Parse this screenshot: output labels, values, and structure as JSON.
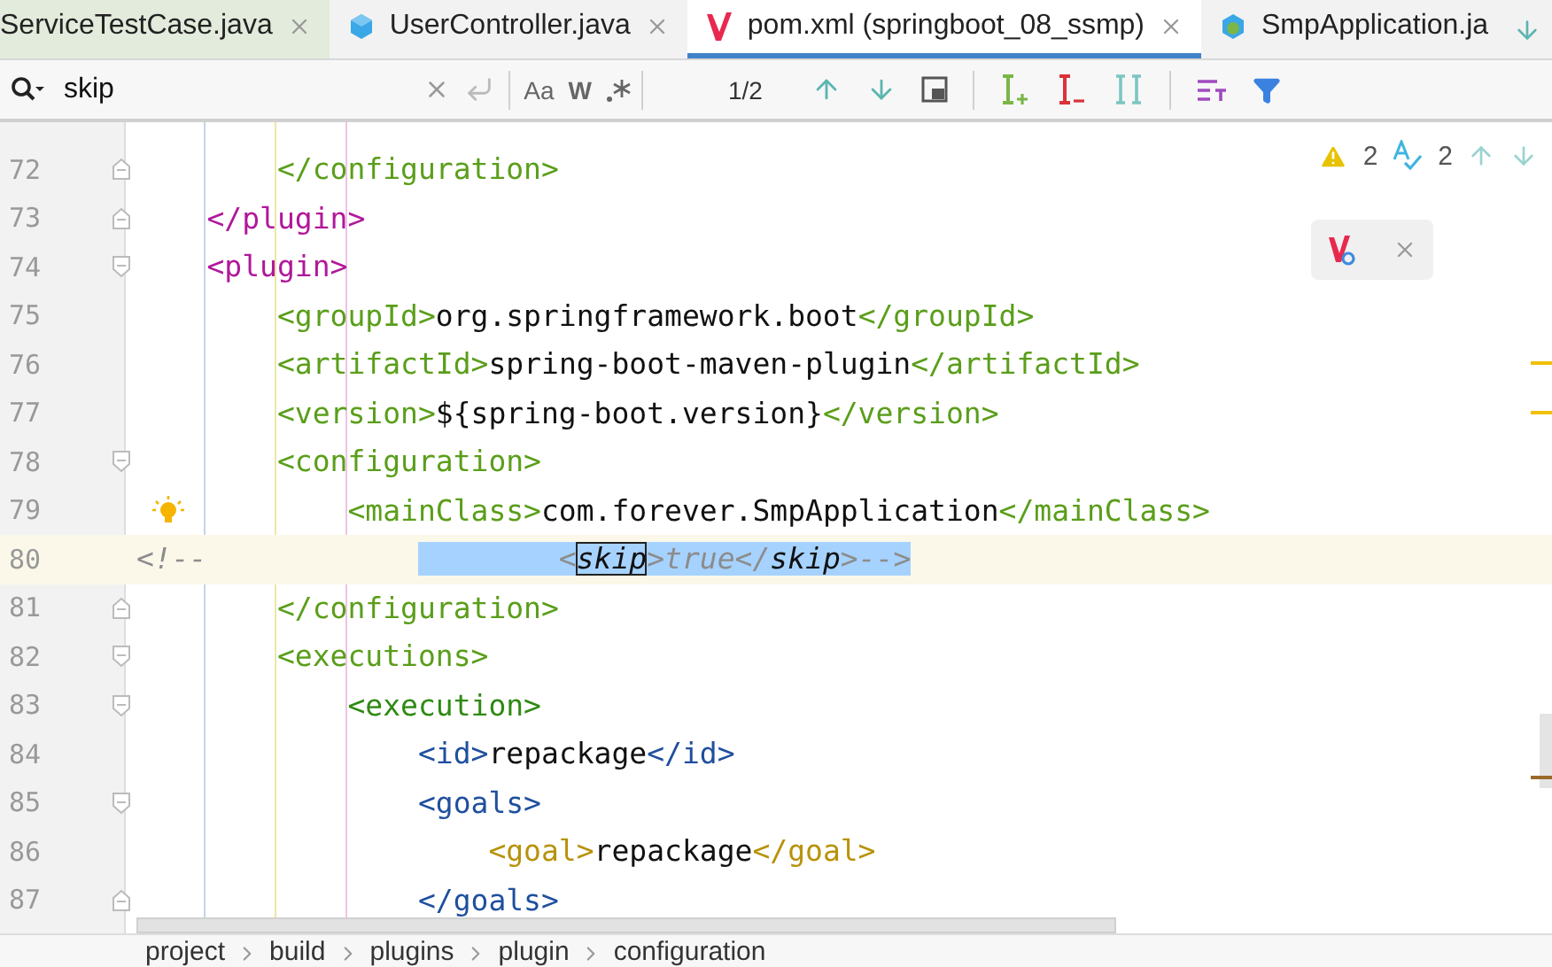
{
  "tabs": [
    {
      "label": "ServiceTestCase.java",
      "kind": "plain",
      "selected": false
    },
    {
      "label": "UserController.java",
      "kind": "cube",
      "selected": false
    },
    {
      "label": "pom.xml (springboot_08_ssmp)",
      "kind": "maven",
      "selected": true
    },
    {
      "label": "SmpApplication.ja",
      "kind": "app",
      "selected": false
    }
  ],
  "find": {
    "query": "skip",
    "case_toggle": "Aa",
    "word_toggle": "W",
    "match_count": "1/2"
  },
  "inspections": {
    "warnings": "2",
    "typos": "2"
  },
  "lines": [
    {
      "number": "72",
      "kind": "closer",
      "current": false,
      "hint": false,
      "segments": [
        {
          "kind": "tag",
          "color": "#5a9e1a",
          "text": "        </configuration>"
        }
      ]
    },
    {
      "number": "73",
      "kind": "closer",
      "current": false,
      "hint": false,
      "segments": [
        {
          "kind": "tag",
          "color": "#b0189a",
          "text": "    </plugin>"
        }
      ]
    },
    {
      "number": "74",
      "kind": "opener",
      "current": false,
      "hint": false,
      "segments": [
        {
          "kind": "tag",
          "color": "#b0189a",
          "text": "    <plugin>"
        }
      ]
    },
    {
      "number": "75",
      "kind": "plain",
      "current": false,
      "hint": false,
      "segments": [
        {
          "kind": "tag",
          "color": "#5a9e1a",
          "text": "        <groupId>"
        },
        {
          "kind": "text",
          "text": "org.springframework.boot"
        },
        {
          "kind": "tag",
          "color": "#5a9e1a",
          "text": "</groupId>"
        }
      ]
    },
    {
      "number": "76",
      "kind": "plain",
      "current": false,
      "hint": false,
      "segments": [
        {
          "kind": "tag",
          "color": "#5a9e1a",
          "text": "        <artifactId>"
        },
        {
          "kind": "text",
          "text": "spring-boot-maven-plugin"
        },
        {
          "kind": "tag",
          "color": "#5a9e1a",
          "text": "</artifactId>"
        }
      ]
    },
    {
      "number": "77",
      "kind": "plain",
      "current": false,
      "hint": false,
      "segments": [
        {
          "kind": "tag",
          "color": "#5a9e1a",
          "text": "        <version>"
        },
        {
          "kind": "text",
          "text": "${spring-boot.version}"
        },
        {
          "kind": "tag",
          "color": "#5a9e1a",
          "text": "</version>"
        }
      ]
    },
    {
      "number": "78",
      "kind": "opener",
      "current": false,
      "hint": false,
      "segments": [
        {
          "kind": "tag",
          "color": "#5a9e1a",
          "text": "        <configuration>"
        }
      ]
    },
    {
      "number": "79",
      "kind": "plain",
      "current": false,
      "hint": true,
      "segments": [
        {
          "kind": "tag",
          "color": "#5a9e1a",
          "text": "            <mainClass>"
        },
        {
          "kind": "text",
          "text": "com.forever.SmpApplication"
        },
        {
          "kind": "tag",
          "color": "#5a9e1a",
          "text": "</mainClass>"
        }
      ]
    },
    {
      "number": "80",
      "kind": "plain",
      "current": true,
      "hint": false,
      "segments": [
        {
          "kind": "comment",
          "text": "<!--            "
        },
        {
          "kind": "selection",
          "text": "        <"
        },
        {
          "kind": "match",
          "selected": true,
          "text": "skip"
        },
        {
          "kind": "selection",
          "text": ">true</"
        },
        {
          "kind": "match",
          "selected": false,
          "text": "skip"
        },
        {
          "kind": "selection",
          "text": ">-->"
        }
      ]
    },
    {
      "number": "81",
      "kind": "closer",
      "current": false,
      "hint": false,
      "segments": [
        {
          "kind": "tag",
          "color": "#5a9e1a",
          "text": "        </configuration>"
        }
      ]
    },
    {
      "number": "82",
      "kind": "opener",
      "current": false,
      "hint": false,
      "segments": [
        {
          "kind": "tag",
          "color": "#5a9e1a",
          "text": "        <executions>"
        }
      ]
    },
    {
      "number": "83",
      "kind": "opener",
      "current": false,
      "hint": false,
      "segments": [
        {
          "kind": "tag",
          "color": "#2e8a12",
          "text": "            <execution>"
        }
      ]
    },
    {
      "number": "84",
      "kind": "plain",
      "current": false,
      "hint": false,
      "segments": [
        {
          "kind": "tag",
          "color": "#1f4f9e",
          "text": "                <id>"
        },
        {
          "kind": "text",
          "text": "repackage"
        },
        {
          "kind": "tag",
          "color": "#1f4f9e",
          "text": "</id>"
        }
      ]
    },
    {
      "number": "85",
      "kind": "opener",
      "current": false,
      "hint": false,
      "segments": [
        {
          "kind": "tag",
          "color": "#1f4f9e",
          "text": "                <goals>"
        }
      ]
    },
    {
      "number": "86",
      "kind": "plain",
      "current": false,
      "hint": false,
      "segments": [
        {
          "kind": "tag",
          "color": "#b8920a",
          "text": "                    <goal>"
        },
        {
          "kind": "text",
          "text": "repackage"
        },
        {
          "kind": "tag",
          "color": "#b8920a",
          "text": "</goal>"
        }
      ]
    },
    {
      "number": "87",
      "kind": "closer",
      "current": false,
      "hint": false,
      "segments": [
        {
          "kind": "tag",
          "color": "#1f4f9e",
          "text": "                </goals>"
        }
      ]
    }
  ],
  "breadcrumbs": [
    "project",
    "build",
    "plugins",
    "plugin",
    "configuration"
  ]
}
